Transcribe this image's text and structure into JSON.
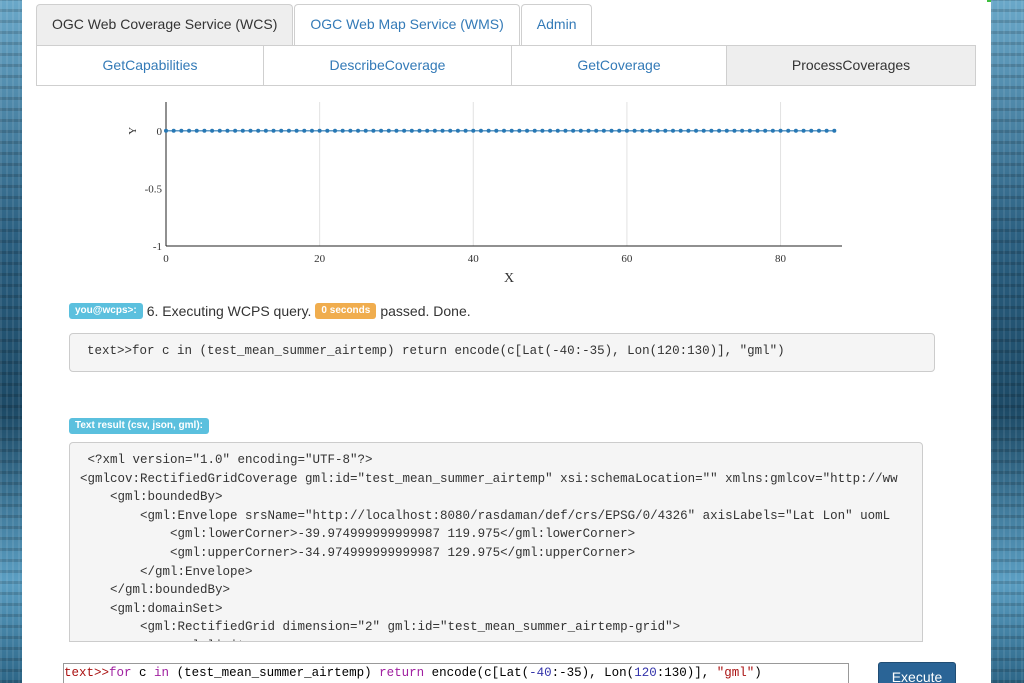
{
  "top_tabs": [
    {
      "label": "OGC Web Coverage Service (WCS)",
      "active": true
    },
    {
      "label": "OGC Web Map Service (WMS)",
      "active": false
    },
    {
      "label": "Admin",
      "active": false
    }
  ],
  "sub_tabs": [
    {
      "label": "GetCapabilities",
      "active": false
    },
    {
      "label": "DescribeCoverage",
      "active": false
    },
    {
      "label": "GetCoverage",
      "active": false
    },
    {
      "label": "ProcessCoverages",
      "active": true
    }
  ],
  "chart_data": {
    "type": "scatter",
    "xlabel": "X",
    "ylabel": "Y",
    "xlim": [
      0,
      88
    ],
    "ylim": [
      -1,
      0.25
    ],
    "x_ticks": [
      "0",
      "20",
      "40",
      "60",
      "80"
    ],
    "y_ticks": [
      "0",
      "-0.5",
      "-1"
    ],
    "y_tick_values": [
      0,
      -0.5,
      -1
    ],
    "x_tick_values": [
      0,
      20,
      40,
      60,
      80
    ],
    "grid": true,
    "point_count": 88,
    "y_value": 0,
    "color": "#2878b4"
  },
  "status": {
    "user_badge": "you@wcps>:",
    "message": "6. Executing WCPS query.",
    "time_badge": "0 seconds",
    "suffix": "passed. Done."
  },
  "query_text": "text>>for c in (test_mean_summer_airtemp) return encode(c[Lat(-40:-35), Lon(120:130)], \"gml\")",
  "text_result_label": "Text result (csv, json, gml):",
  "result_lines": [
    " <?xml version=\"1.0\" encoding=\"UTF-8\"?>",
    "<gmlcov:RectifiedGridCoverage gml:id=\"test_mean_summer_airtemp\" xsi:schemaLocation=\"\" xmlns:gmlcov=\"http://ww",
    "    <gml:boundedBy>",
    "        <gml:Envelope srsName=\"http://localhost:8080/rasdaman/def/crs/EPSG/0/4326\" axisLabels=\"Lat Lon\" uomL",
    "            <gml:lowerCorner>-39.974999999999987 119.975</gml:lowerCorner>",
    "            <gml:upperCorner>-34.974999999999987 129.975</gml:upperCorner>",
    "        </gml:Envelope>",
    "    </gml:boundedBy>",
    "    <gml:domainSet>",
    "        <gml:RectifiedGrid dimension=\"2\" gml:id=\"test_mean_summer_airtemp-grid\">",
    "            <gml:limits>"
  ],
  "command_input": {
    "prefix": "text>>",
    "kw_for": "for",
    "var": " c ",
    "kw_in": "in",
    "p1": " (test_mean_summer_airtemp) ",
    "kw_return": "return",
    "p2": " encode(c[Lat(",
    "n1": "-40",
    "p3": ":-35), Lon(",
    "n2": "120",
    "p4": ":130)], ",
    "s1": "\"gml\"",
    "p5": ")"
  },
  "execute_label": "Execute"
}
